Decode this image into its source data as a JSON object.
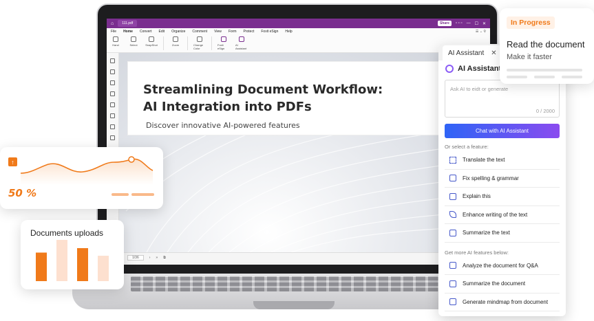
{
  "app": {
    "file_tab": "111.pdf",
    "share_label": "Share",
    "menu": [
      "File",
      "Home",
      "Convert",
      "Edit",
      "Organize",
      "Comment",
      "View",
      "Form",
      "Protect",
      "Foxit eSign",
      "Help"
    ],
    "ribbon": [
      {
        "label": "Hand",
        "icon": "hand-icon"
      },
      {
        "label": "Select",
        "icon": "select-icon"
      },
      {
        "label": "SnapShot",
        "icon": "snapshot-icon"
      },
      {
        "label": "Zoom",
        "icon": "zoom-icon"
      },
      {
        "label": "Change Color",
        "icon": "change-color-icon"
      },
      {
        "label": "Foxit eSign",
        "icon": "esign-icon"
      },
      {
        "label": "AI Assistant",
        "icon": "ai-assistant-icon"
      }
    ],
    "page_indicator": "1/36"
  },
  "document": {
    "title_line1": "Streamlining Document Workflow:",
    "title_line2": "AI Integration into PDFs",
    "subtitle": "Discover innovative AI-powered features"
  },
  "ai_panel": {
    "tab_label": "AI Assistant",
    "tab_close": "✕",
    "header": "AI Assistant",
    "input_placeholder": "Ask AI to eidt or generate",
    "char_count": "0 / 2000",
    "chat_button": "Chat with AI Assistant",
    "section1": "Or select a feature:",
    "features": [
      {
        "label": "Translate the text",
        "icon": "translate-icon"
      },
      {
        "label": "Fix spelling & grammar",
        "icon": "spelling-icon"
      },
      {
        "label": "Explain this",
        "icon": "explain-icon"
      },
      {
        "label": "Enhance writing of the text",
        "icon": "pen-icon"
      },
      {
        "label": "Summarize the text",
        "icon": "summarize-icon"
      }
    ],
    "section2": "Get more AI features below:",
    "more_features": [
      {
        "label": "Analyze the document for Q&A",
        "icon": "analyze-icon"
      },
      {
        "label": "Summarize the document",
        "icon": "summarize-doc-icon"
      },
      {
        "label": "Generate mindmap from document",
        "icon": "mindmap-icon"
      }
    ]
  },
  "progress_card": {
    "badge": "In Progress",
    "title": "Read the document",
    "subtitle": "Make it faster"
  },
  "percent_card": {
    "arrow": "↑",
    "value_label": "50 %",
    "accent": "#f07a1a"
  },
  "uploads_card": {
    "title": "Documents uploads",
    "bar_values": [
      0.45,
      0.65,
      0.52,
      0.4
    ],
    "bar_colors": [
      "#f07a1a",
      "#fde0cf",
      "#f07a1a",
      "#fde0cf"
    ]
  },
  "colors": {
    "brand_purple": "#7a2e8f",
    "accent_orange": "#f07a1a",
    "ai_blue": "#2f64f6",
    "ai_violet": "#8a4bef"
  }
}
